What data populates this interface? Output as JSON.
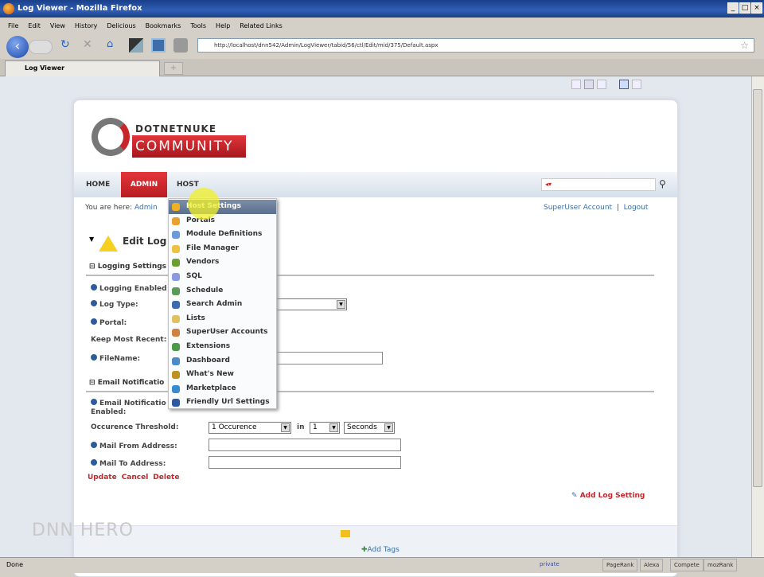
{
  "window": {
    "title": "Log Viewer - Mozilla Firefox"
  },
  "menu": [
    "File",
    "Edit",
    "View",
    "History",
    "Delicious",
    "Bookmarks",
    "Tools",
    "Help",
    "Related Links"
  ],
  "url": "http://localhost/dnn542/Admin/LogViewer/tabid/56/ctl/Edit/mid/375/Default.aspx",
  "tab": {
    "label": "Log Viewer",
    "new_tab": "+"
  },
  "logo": {
    "top": "DOTNETNUKE",
    "bottom": "COMMUNITY"
  },
  "nav": {
    "home": "HOME",
    "admin": "ADMIN",
    "host": "HOST"
  },
  "breadcrumb": {
    "label": "You are here:",
    "item": "Admin"
  },
  "user": {
    "account": "SuperUser Account",
    "separator": "|",
    "logout": "Logout"
  },
  "module": {
    "title": "Edit Log S"
  },
  "logging": {
    "section": "Logging Settings",
    "enabled": "Logging Enabled",
    "log_type": "Log Type:",
    "portal": "Portal:",
    "keep_recent": "Keep Most Recent:",
    "filename": "FileName:"
  },
  "email": {
    "section": "Email Notificatio",
    "enabled_1": "Email Notificatio",
    "enabled_2": "Enabled:",
    "threshold": "Occurence Threshold:",
    "threshold_value": "1 Occurence",
    "in": "in",
    "count": "1",
    "unit": "Seconds",
    "from": "Mail From Address:",
    "to": "Mail To Address:"
  },
  "actions": {
    "update": "Update",
    "cancel": "Cancel",
    "delete": "Delete",
    "add": "Add Log Setting"
  },
  "host_menu": [
    "Host Settings",
    "Portals",
    "Module Definitions",
    "File Manager",
    "Vendors",
    "SQL",
    "Schedule",
    "Search Admin",
    "Lists",
    "SuperUser Accounts",
    "Extensions",
    "Dashboard",
    "What's New",
    "Marketplace",
    "Friendly Url Settings"
  ],
  "footer": {
    "add_tags": "Add Tags"
  },
  "status": {
    "text": "Done",
    "private": "private",
    "pagerank": "PageRank",
    "alexa": "Alexa",
    "compete": "Compete",
    "mozrank": "mozRank"
  },
  "watermark": "DNN HERO"
}
